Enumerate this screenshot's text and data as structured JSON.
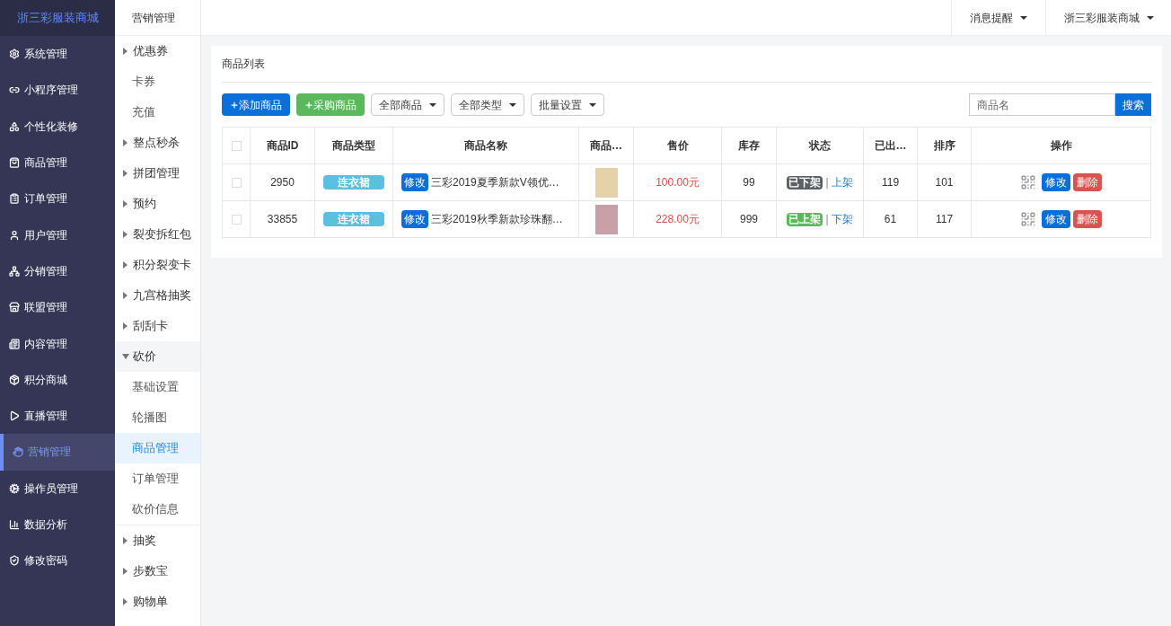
{
  "brand": "浙三彩服装商城",
  "main_menu": [
    {
      "label": "系统管理",
      "selected": false
    },
    {
      "label": "小程序管理",
      "selected": false
    },
    {
      "label": "个性化装修",
      "selected": false
    },
    {
      "label": "商品管理",
      "selected": false
    },
    {
      "label": "订单管理",
      "selected": false
    },
    {
      "label": "用户管理",
      "selected": false
    },
    {
      "label": "分销管理",
      "selected": false
    },
    {
      "label": "联盟管理",
      "selected": false
    },
    {
      "label": "内容管理",
      "selected": false
    },
    {
      "label": "积分商城",
      "selected": false
    },
    {
      "label": "直播管理",
      "selected": false
    },
    {
      "label": "营销管理",
      "selected": true
    },
    {
      "label": "操作员管理",
      "selected": false
    },
    {
      "label": "数据分析",
      "selected": false
    },
    {
      "label": "修改密码",
      "selected": false
    }
  ],
  "sub_menu": {
    "title": "营销管理",
    "items": [
      {
        "kind": "group",
        "label": "优惠券",
        "expanded": false
      },
      {
        "kind": "link",
        "label": "卡券"
      },
      {
        "kind": "link",
        "label": "充值"
      },
      {
        "kind": "group",
        "label": "整点秒杀",
        "expanded": false
      },
      {
        "kind": "group",
        "label": "拼团管理",
        "expanded": false
      },
      {
        "kind": "group",
        "label": "预约",
        "expanded": false
      },
      {
        "kind": "group",
        "label": "裂变拆红包",
        "expanded": false
      },
      {
        "kind": "group",
        "label": "积分裂变卡",
        "expanded": false
      },
      {
        "kind": "group",
        "label": "九宫格抽奖",
        "expanded": false
      },
      {
        "kind": "group",
        "label": "刮刮卡",
        "expanded": false
      },
      {
        "kind": "group",
        "label": "砍价",
        "expanded": true,
        "children": [
          {
            "label": "基础设置",
            "selected": false
          },
          {
            "label": "轮播图",
            "selected": false
          },
          {
            "label": "商品管理",
            "selected": true
          },
          {
            "label": "订单管理",
            "selected": false
          },
          {
            "label": "砍价信息",
            "selected": false
          }
        ]
      },
      {
        "kind": "group",
        "label": "抽奖",
        "expanded": false
      },
      {
        "kind": "group",
        "label": "步数宝",
        "expanded": false
      },
      {
        "kind": "group",
        "label": "购物单",
        "expanded": false
      }
    ]
  },
  "top_bar": {
    "menus": [
      "消息提醒",
      "浙三彩服装商城"
    ]
  },
  "panel": {
    "title": "商品列表",
    "toolbar": {
      "add_button": "添加商品",
      "purchase_button": "采购商品",
      "dropdowns": [
        "全部商品",
        "全部类型",
        "批量设置"
      ],
      "search": {
        "placeholder": "商品名",
        "button": "搜索"
      }
    },
    "table": {
      "columns": [
        "商品ID",
        "商品类型",
        "商品名称",
        "商品…",
        "售价",
        "库存",
        "状态",
        "已出…",
        "排序",
        "操作"
      ],
      "select_all": {
        "checked": false
      },
      "rows": [
        {
          "checked": false,
          "id": "2950",
          "type": "连衣裙",
          "edit": "修改",
          "name": "三彩2019夏季新款V领优…",
          "price": "100.00元",
          "stock": "99",
          "listed": false,
          "status": "已下架",
          "separator": "|",
          "toggle": "上架",
          "sold": "119",
          "sort": "101",
          "actions": [
            "修改",
            "删除"
          ]
        },
        {
          "checked": false,
          "id": "33855",
          "type": "连衣裙",
          "edit": "修改",
          "name": "三彩2019秋季新款珍珠翻…",
          "price": "228.00元",
          "stock": "999",
          "listed": true,
          "status": "已上架",
          "separator": "|",
          "toggle": "下架",
          "sold": "61",
          "sort": "117",
          "actions": [
            "修改",
            "删除"
          ]
        }
      ]
    }
  }
}
